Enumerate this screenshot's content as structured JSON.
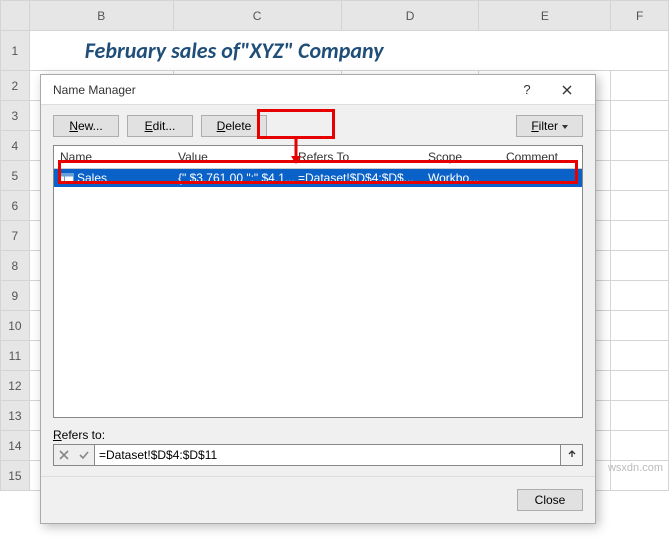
{
  "sheet": {
    "columns": [
      "B",
      "C",
      "D",
      "E",
      "F"
    ],
    "rows": [
      "1",
      "2",
      "3",
      "4",
      "5",
      "6",
      "7",
      "8",
      "9",
      "10",
      "11",
      "12",
      "13",
      "14",
      "15"
    ],
    "title_text": "February sales of\"XYZ\" Company"
  },
  "dialog": {
    "title": "Name Manager",
    "help_label": "?",
    "buttons": {
      "new_pre": "N",
      "new_post": "ew...",
      "edit_pre": "E",
      "edit_post": "dit...",
      "delete_pre": "D",
      "delete_post": "elete",
      "filter_pre": "F",
      "filter_post": "ilter"
    },
    "list": {
      "headers": {
        "name": "Name",
        "value": "Value",
        "refers": "Refers To",
        "scope": "Scope",
        "comment": "Comment"
      },
      "rows": [
        {
          "name": "Sales",
          "value": "{\" $3,761.00 \";\" $4,1...",
          "refers": "=Dataset!$D$4:$D$...",
          "scope": "Workbo...",
          "comment": ""
        }
      ]
    },
    "refers": {
      "label_pre": "R",
      "label_post": "efers to:",
      "value": "=Dataset!$D$4:$D$11"
    },
    "footer": {
      "close": "Close"
    }
  },
  "watermark": "wsxdn.com"
}
